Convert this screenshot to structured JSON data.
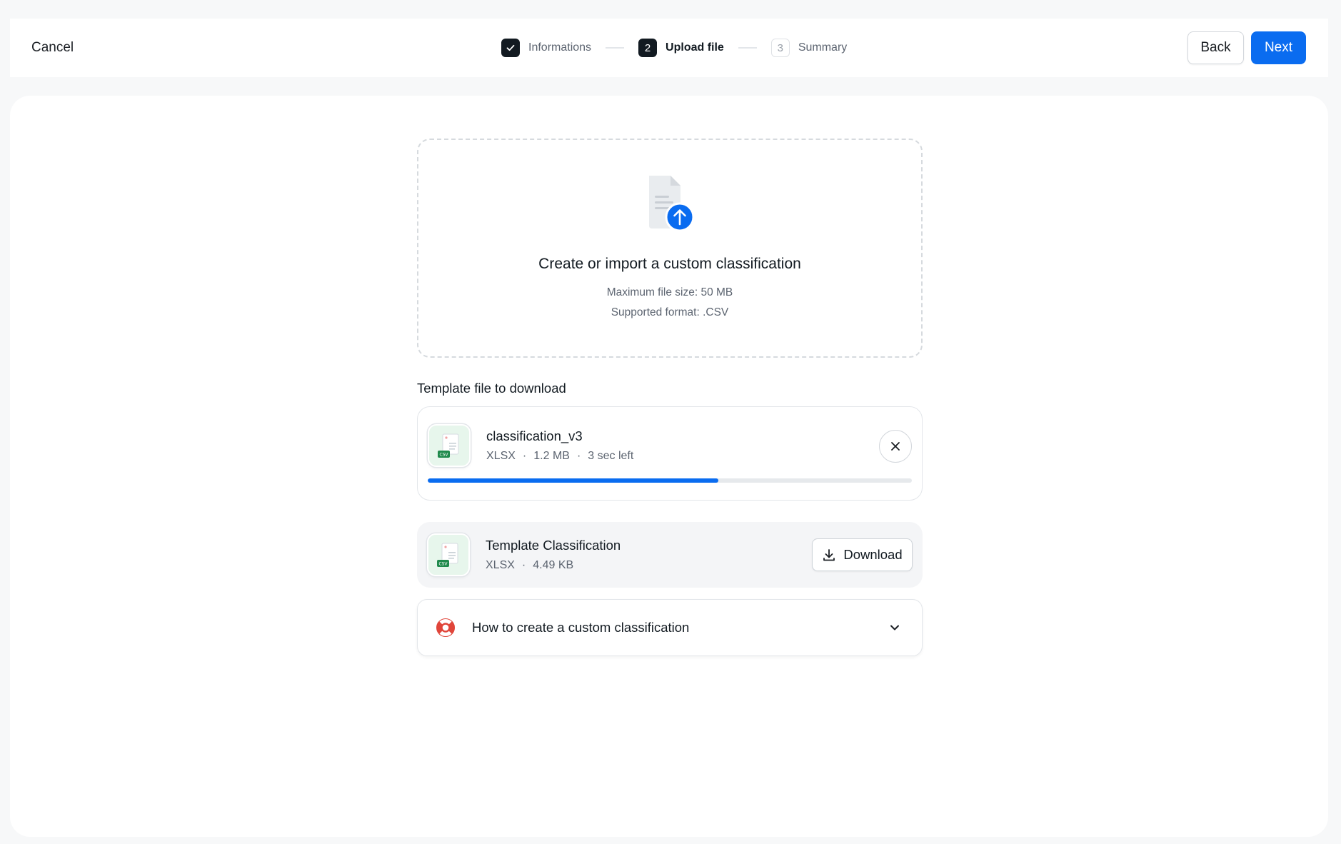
{
  "header": {
    "cancel_label": "Cancel",
    "steps": [
      {
        "number": "✓",
        "label": "Informations",
        "state": "done"
      },
      {
        "number": "2",
        "label": "Upload file",
        "state": "active"
      },
      {
        "number": "3",
        "label": "Summary",
        "state": "todo"
      }
    ],
    "back_label": "Back",
    "next_label": "Next"
  },
  "dropzone": {
    "title": "Create or import a custom classification",
    "max_size": "Maximum file size: 50 MB",
    "format": "Supported format: .CSV",
    "icon": "file-upload-icon"
  },
  "template_section": {
    "title": "Template file to download"
  },
  "uploading_file": {
    "name": "classification_v3",
    "type": "XLSX",
    "size": "1.2 MB",
    "time_left": "3 sec left",
    "progress_percent": 60,
    "thumb_tag": "CSV"
  },
  "template_file": {
    "name": "Template Classification",
    "type": "XLSX",
    "size": "4.49 KB",
    "download_label": "Download",
    "thumb_tag": "CSV"
  },
  "help": {
    "label": "How to create a custom classification",
    "icon": "lifebuoy-icon"
  },
  "colors": {
    "accent": "#0a6cf0",
    "dark": "#121a21",
    "csv_green": "#1f8a4c"
  }
}
